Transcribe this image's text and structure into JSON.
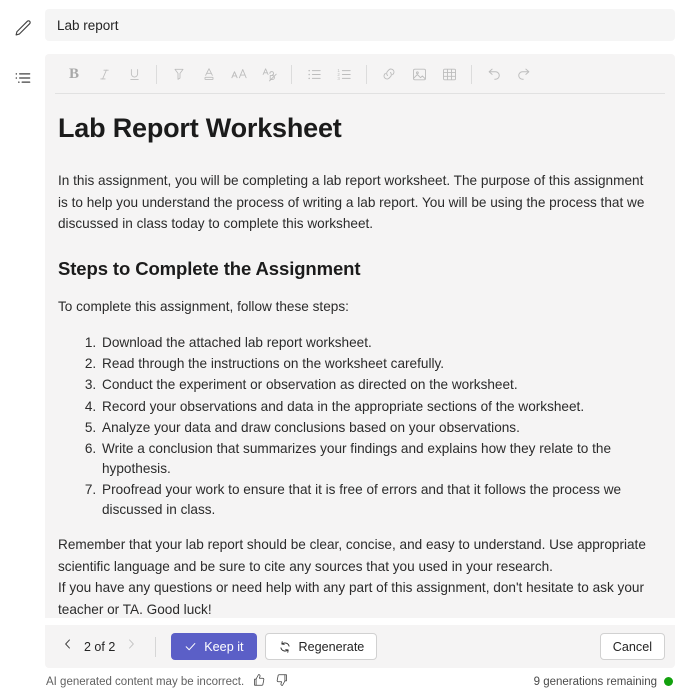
{
  "rail": {
    "items": [
      {
        "icon": "pencil-icon",
        "name": "rail-item-edit"
      },
      {
        "icon": "list-outline-icon",
        "name": "rail-item-outline"
      }
    ]
  },
  "title_field": {
    "value": "Lab report",
    "placeholder": "Title"
  },
  "toolbar": {
    "groups": [
      [
        {
          "icon": "bold-icon",
          "label": "B",
          "name": "bold-button"
        },
        {
          "icon": "italic-icon",
          "label": "I",
          "name": "italic-button"
        },
        {
          "icon": "underline-icon",
          "label": "U",
          "name": "underline-button"
        }
      ],
      [
        {
          "icon": "highlight-icon",
          "name": "highlight-button"
        },
        {
          "icon": "font-color-icon",
          "name": "font-color-button"
        },
        {
          "icon": "font-size-icon",
          "name": "font-size-button"
        },
        {
          "icon": "clear-formatting-icon",
          "name": "clear-formatting-button"
        }
      ],
      [
        {
          "icon": "bulleted-list-icon",
          "name": "bulleted-list-button"
        },
        {
          "icon": "numbered-list-icon",
          "name": "numbered-list-button"
        }
      ],
      [
        {
          "icon": "link-icon",
          "name": "insert-link-button"
        },
        {
          "icon": "image-icon",
          "name": "insert-image-button"
        },
        {
          "icon": "table-icon",
          "name": "insert-table-button"
        }
      ],
      [
        {
          "icon": "undo-icon",
          "name": "undo-button"
        },
        {
          "icon": "redo-icon",
          "name": "redo-button"
        }
      ]
    ]
  },
  "document": {
    "title": "Lab Report Worksheet",
    "intro": "In this assignment, you will be completing a lab report worksheet. The purpose of this assignment is to help you understand the process of writing a lab report. You will be using the process that we discussed in class today to complete this worksheet.",
    "section_heading": "Steps to Complete the Assignment",
    "steps_lead": "To complete this assignment, follow these steps:",
    "steps": [
      "Download the attached lab report worksheet.",
      "Read through the instructions on the worksheet carefully.",
      "Conduct the experiment or observation as directed on the worksheet.",
      "Record your observations and data in the appropriate sections of the worksheet.",
      "Analyze your data and draw conclusions based on your observations.",
      "Write a conclusion that summarizes your findings and explains how they relate to the hypothesis.",
      "Proofread your work to ensure that it is free of errors and that it follows the process we discussed in class."
    ],
    "closing_1": "Remember that your lab report should be clear, concise, and easy to understand. Use appropriate scientific language and be sure to cite any sources that you used in your research.",
    "closing_2": "If you have any questions or need help with any part of this assignment, don't hesitate to ask your teacher or TA. Good luck!"
  },
  "actionbar": {
    "prev_label": "previous-generation",
    "next_label": "next-generation",
    "pager": "2 of 2",
    "keep_label": "Keep it",
    "regenerate_label": "Regenerate",
    "cancel_label": "Cancel",
    "primary_color": "#5B5FC7"
  },
  "footer": {
    "disclaimer": "AI generated content may be incorrect.",
    "thumbs_up": "thumbs-up-icon",
    "thumbs_down": "thumbs-down-icon",
    "generations_remaining": "9 generations remaining",
    "status_color": "#13A10E"
  }
}
